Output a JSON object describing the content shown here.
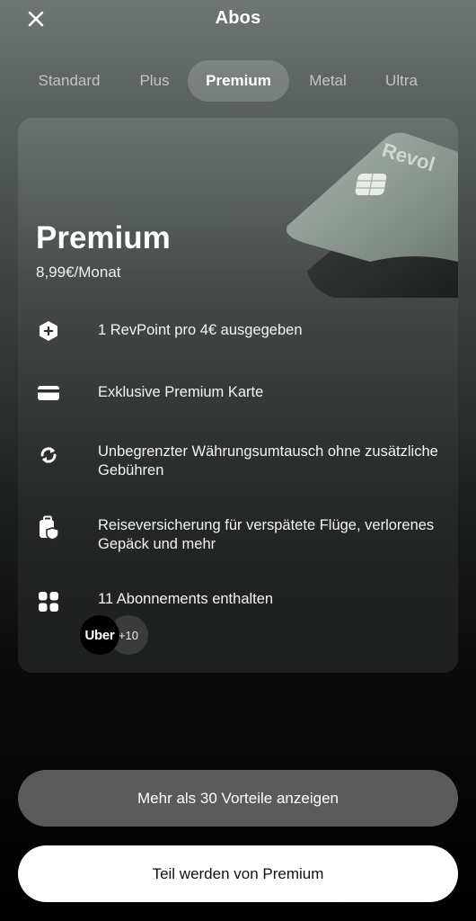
{
  "header": {
    "title": "Abos"
  },
  "tabs": [
    {
      "label": "Standard",
      "active": false
    },
    {
      "label": "Plus",
      "active": false
    },
    {
      "label": "Premium",
      "active": true
    },
    {
      "label": "Metal",
      "active": false
    },
    {
      "label": "Ultra",
      "active": false
    }
  ],
  "plan": {
    "name": "Premium",
    "price": "8,99€/Monat",
    "card_brand_text": "Revol",
    "features": [
      {
        "icon": "revpoint-icon",
        "text": "1 RevPoint pro 4€ ausgegeben"
      },
      {
        "icon": "card-icon",
        "text": "Exklusive Premium Karte"
      },
      {
        "icon": "exchange-icon",
        "text": "Unbegrenzter Währungsumtausch ohne zusätzliche Gebühren"
      },
      {
        "icon": "luggage-shield-icon",
        "text": "Reiseversicherung für verspätete Flüge, verlorenes Gepäck und mehr"
      },
      {
        "icon": "apps-icon",
        "text": "11 Abonnements enthalten"
      }
    ],
    "subscriptions": {
      "first": "Uber",
      "more": "+10"
    }
  },
  "actions": {
    "more_benefits": "Mehr als 30 Vorteile anzeigen",
    "join": "Teil werden von Premium"
  },
  "colors": {
    "primary_button_bg": "#ffffff",
    "secondary_button_bg": "#5b5b5b"
  }
}
